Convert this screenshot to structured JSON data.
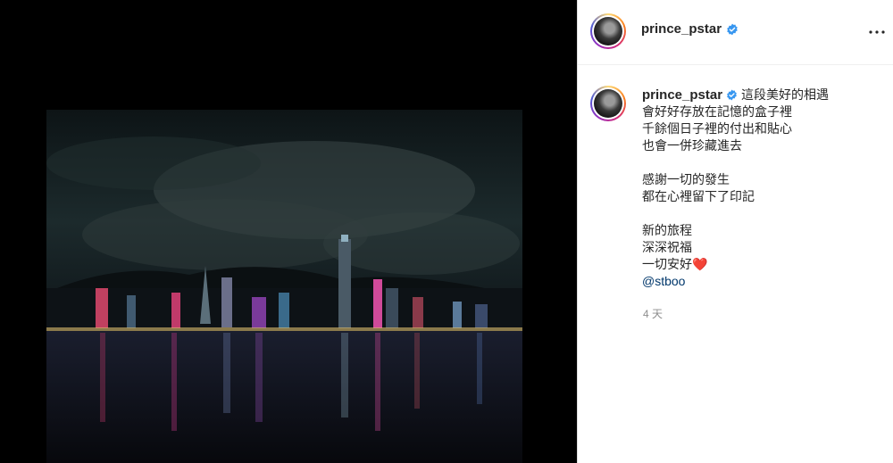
{
  "post": {
    "username": "prince_pstar",
    "verified": true,
    "more_icon": "more-horizontal-icon",
    "photo_alt": "",
    "caption_lines": [
      "這段美好的相遇",
      "會好好存放在記憶的盒子裡",
      "千餘個日子裡的付出和貼心",
      "也會一併珍藏進去",
      "",
      "感謝一切的發生",
      "都在心裡留下了印記",
      "",
      "新的旅程",
      "深深祝福",
      "一切安好",
      "@stboo"
    ],
    "heart_emoji": "❤️",
    "timestamp": "4 天"
  },
  "colors": {
    "verified_blue": "#3897f0",
    "mention": "#00376b",
    "heart": "#ed4956"
  }
}
